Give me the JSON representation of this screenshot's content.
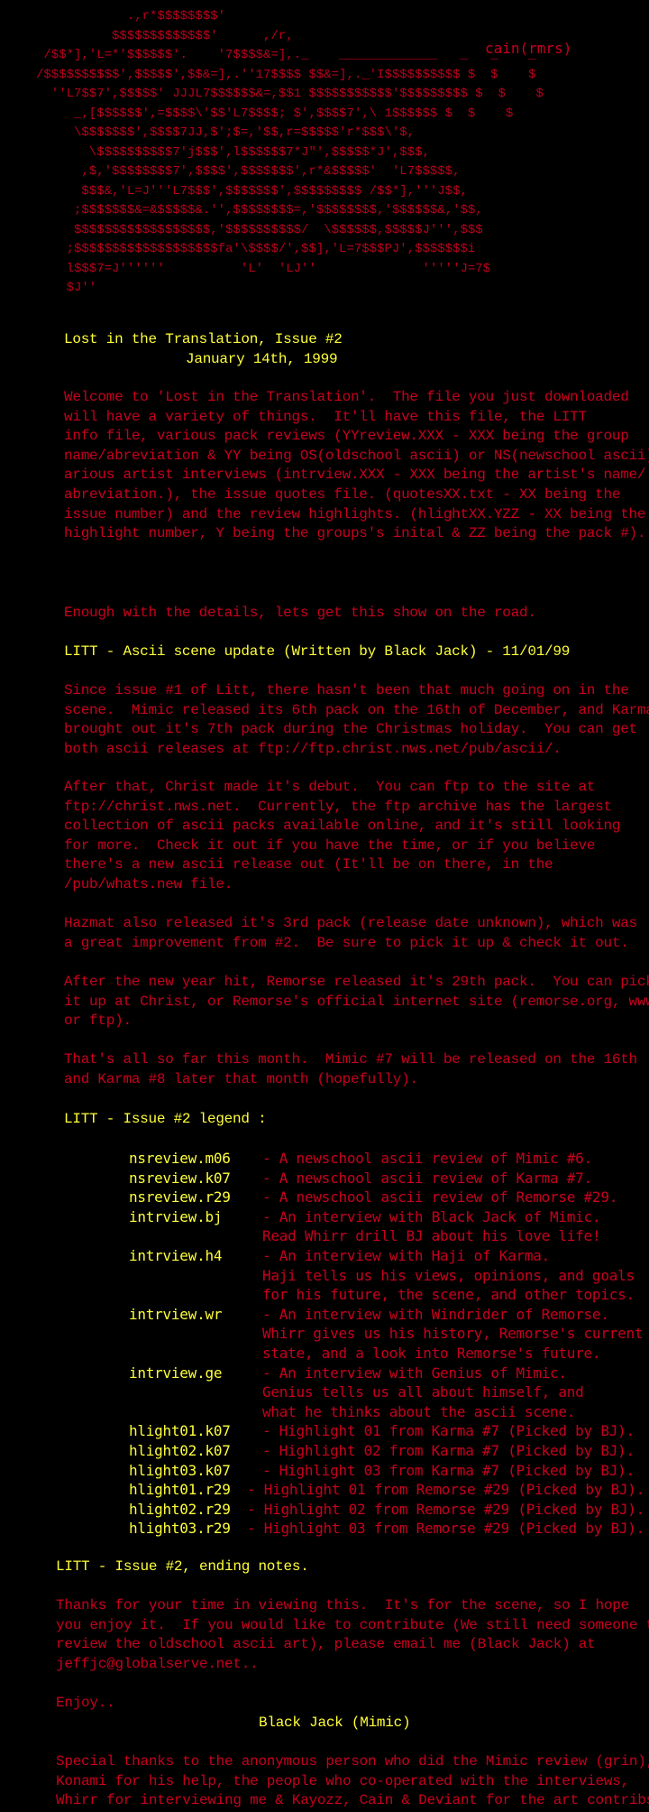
{
  "header": {
    "art": "            .,r*$$$$$$$$'\n          $$$$$$$$$$$$$'      ,/r,\n /$$*],'L=*'$$$$$$'.    '7$$$$&=],._    _____________   _   _    _\n/$$$$$$$$$$',$$$$$',$$&=],.''17$$$$ $$&=],._'I$$$$$$$$$$ $  $    $\n  ''L7$$7',$$$$$' JJJL7$$$$$$&=,$$1 $$$$$$$$$$$'$$$$$$$$$ $  $    $\n     _,[$$$$$$',=$$$$\\'$$'L7$$$$; $',$$$$7',\\ 1$$$$$$ $  $    $\n     \\$$$$$$$',$$$$7JJ,$';$=,'$$,r=$$$$$'r*$$$\\'$,\n       \\$$$$$$$$$$7'j$$$',l$$$$$$7*J\"',$$$$$*J',$$$,\n      ,$,'$$$$$$$$7',$$$$',$$$$$$$',r*&$$$$$'  'L7$$$$$,\n      $$$&,'L=J'''L7$$$',$$$$$$$',$$$$$$$$$ /$$*],'''J$$,\n     ;$$$$$$$&=&$$$$$&.'',$$$$$$$$=,'$$$$$$$$,'$$$$$$&,'$$,\n     $$$$$$$$$$$$$$$$$$,'$$$$$$$$$$/  \\$$$$$$,$$$$$J''',$$$\n    ;$$$$$$$$$$$$$$$$$$$fa'\\$$$$/',$$],'L=7$$$PJ',$$$$$$$i\n    l$$$7=J''''''          'L'  'LJ''              '''''J=7$\n    $J''",
    "tag": "cain(rmrs)"
  },
  "intro": {
    "title": "Lost in the Translation, Issue #2",
    "date": "January 14th, 1999",
    "welcome": "Welcome to 'Lost in the Translation'.  The file you just downloaded\nwill have a variety of things.  It'll have this file, the LITT\ninfo file, various pack reviews (YYreview.XXX - XXX being the group\nname/abreviation & YY being OS(oldschool ascii) or NS(newschool ascii))\narious artist interviews (intrview.XXX - XXX being the artist's name/\nabreviation.), the issue quotes file. (quotesXX.txt - XX being the\nissue number) and the review highlights. (hlightXX.YZZ - XX being the\nhighlight number, Y being the groups's inital & ZZ being the pack #).",
    "enough": "Enough with the details, lets get this show on the road."
  },
  "update": {
    "heading": "LITT - Ascii scene update (Written by Black Jack) - 11/01/99",
    "p1": "Since issue #1 of Litt, there hasn't been that much going on in the\nscene.  Mimic released its 6th pack on the 16th of December, and Karma\nbrought out it's 7th pack during the Christmas holiday.  You can get\nboth ascii releases at ftp://ftp.christ.nws.net/pub/ascii/.",
    "p2": "After that, Christ made it's debut.  You can ftp to the site at\nftp://christ.nws.net.  Currently, the ftp archive has the largest\ncollection of ascii packs available online, and it's still looking\nfor more.  Check it out if you have the time, or if you believe\nthere's a new ascii release out (It'll be on there, in the\n/pub/whats.new file.",
    "p3": "Hazmat also released it's 3rd pack (release date unknown), which was\na great improvement from #2.  Be sure to pick it up & check it out.",
    "p4": "After the new year hit, Remorse released it's 29th pack.  You can pick\nit up at Christ, or Remorse's official internet site (remorse.org, www\nor ftp).",
    "p5": "That's all so far this month.  Mimic #7 will be released on the 16th\nand Karma #8 later that month (hopefully)."
  },
  "legend": {
    "heading": "LITT - Issue #2 legend :",
    "rows": [
      {
        "file": "nsreview.m06",
        "desc": "- A newschool ascii review of Mimic #6.",
        "extra": []
      },
      {
        "file": "nsreview.k07",
        "desc": "- A newschool ascii review of Karma #7.",
        "extra": []
      },
      {
        "file": "nsreview.r29",
        "desc": "- A newschool ascii review of Remorse #29.",
        "extra": []
      },
      {
        "file": "intrview.bj",
        "desc": "- An interview with Black Jack of Mimic.",
        "extra": [
          "Read Whirr drill BJ about his love life!"
        ]
      },
      {
        "file": "intrview.h4",
        "desc": "- An interview with Haji of Karma.",
        "extra": [
          "Haji tells us his views, opinions, and goals",
          "for his future, the scene, and other topics."
        ]
      },
      {
        "file": "intrview.wr",
        "desc": "- An interview with Windrider of Remorse.",
        "extra": [
          "Whirr gives us his history, Remorse's current",
          "state, and a look into Remorse's future."
        ]
      },
      {
        "file": "intrview.ge",
        "desc": "- An interview with Genius of Mimic.",
        "extra": [
          "Genius tells us all about himself, and",
          "what he thinks about the ascii scene."
        ]
      },
      {
        "file": "hlight01.k07",
        "desc": "- Highlight 01 from Karma #7 (Picked by BJ).",
        "extra": []
      },
      {
        "file": "hlight02.k07",
        "desc": "- Highlight 02 from Karma #7 (Picked by BJ).",
        "extra": []
      },
      {
        "file": "hlight03.k07",
        "desc": "- Highlight 03 from Karma #7 (Picked by BJ).",
        "extra": []
      },
      {
        "file": "hlight01.r29",
        "desc": "- Highlight 01 from Remorse #29 (Picked by BJ).",
        "extra": []
      },
      {
        "file": "hlight02.r29",
        "desc": "- Highlight 02 from Remorse #29 (Picked by BJ).",
        "extra": []
      },
      {
        "file": "hlight03.r29",
        "desc": "- Highlight 03 from Remorse #29 (Picked by BJ).",
        "extra": []
      }
    ]
  },
  "ending": {
    "heading": "LITT - Issue #2, ending notes.",
    "thanks": "Thanks for your time in viewing this.  It's for the scene, so I hope\nyou enjoy it.  If you would like to contribute (We still need someone to\nreview the oldschool ascii art), please email me (Black Jack) at\njeffjc@globalserve.net..",
    "enjoy": "Enjoy..",
    "signature": "Black Jack (Mimic)",
    "special": "Special thanks to the anonymous person who did the Mimic review (grin),\nKonami for his help, the people who co-operated with the interviews,\nWhirr for interviewing me & Kayozz, Cain & Deviant for the art contribs."
  },
  "colors": {
    "background": "#000000",
    "text_red": "#c8001e",
    "highlight_yellow": "#ffff3a"
  }
}
